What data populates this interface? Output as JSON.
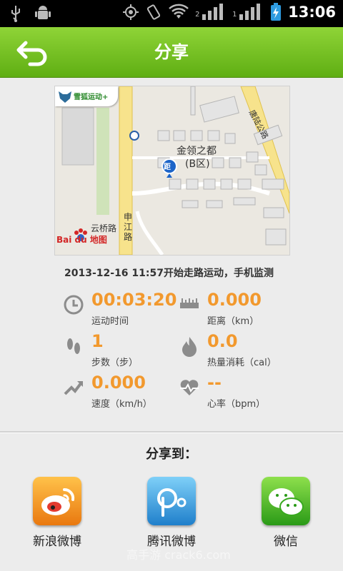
{
  "status_bar": {
    "time": "13:06",
    "sim1_label": "2",
    "sim2_label": "1",
    "icons": [
      "usb-icon",
      "android-debug-icon",
      "gps-icon",
      "vibrate-icon",
      "wifi-icon",
      "signal-icon",
      "battery-charging-icon"
    ]
  },
  "header": {
    "title": "分享",
    "back_icon": "back-arrow-icon"
  },
  "map": {
    "app_badge": "雪狐运动+",
    "area_name_1": "金领之都",
    "area_name_2": "(B区)",
    "marker_label": "距",
    "road_1": "云桥路",
    "road_2": "申江路",
    "road_3": "唐陆公路",
    "baidu_logo": "Bai du 地图"
  },
  "workout": {
    "summary": "2013-12-16 11:57开始走路运动，手机监测",
    "stats": [
      {
        "value": "00:03:20",
        "label": "运动时间",
        "icon": "clock-icon"
      },
      {
        "value": "0.000",
        "label": "距离（km）",
        "icon": "ruler-icon"
      },
      {
        "value": "1",
        "label": "步数（步）",
        "icon": "footprints-icon"
      },
      {
        "value": "0.0",
        "label": "热量消耗（cal）",
        "icon": "flame-icon"
      },
      {
        "value": "0.000",
        "label": "速度（km/h）",
        "icon": "speed-arrow-icon"
      },
      {
        "value": "--",
        "label": "心率（bpm）",
        "icon": "heart-rate-icon"
      }
    ]
  },
  "share": {
    "title": "分享到：",
    "targets": [
      {
        "label": "新浪微博",
        "icon": "sina-weibo-icon",
        "color": "#f08d1c"
      },
      {
        "label": "腾讯微博",
        "icon": "tencent-weibo-icon",
        "color": "#2d8fd6"
      },
      {
        "label": "微信",
        "icon": "wechat-icon",
        "color": "#3cb11f"
      }
    ]
  },
  "colors": {
    "header_green": "#6dbd1c",
    "value_orange": "#f2992e"
  },
  "watermark": "高手游 crack6.com"
}
